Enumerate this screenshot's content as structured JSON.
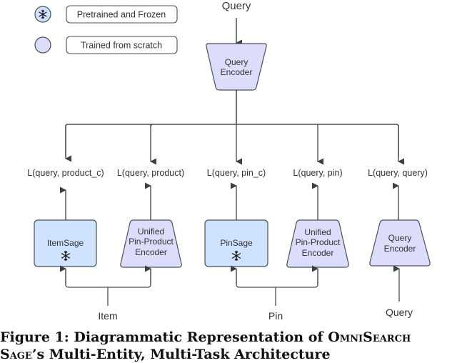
{
  "legend": {
    "items": [
      {
        "label": "Pretrained and Frozen",
        "icon": "snowflake-icon",
        "color": "#cfe2ff"
      },
      {
        "label": "Trained from scratch",
        "icon": "circle",
        "color": "#dcdcfb"
      }
    ]
  },
  "top": {
    "input_label": "Query",
    "encoder_label_line1": "Query",
    "encoder_label_line2": "Encoder"
  },
  "losses": [
    "L(query, product_c)",
    "L(query, product)",
    "L(query, pin_c)",
    "L(query, pin)",
    "L(query, query)"
  ],
  "encoders": [
    {
      "line1": "ItemSage",
      "frozen": true
    },
    {
      "line1": "Unified",
      "line2": "Pin-Product",
      "line3": "Encoder",
      "frozen": false
    },
    {
      "line1": "PinSage",
      "frozen": true
    },
    {
      "line1": "Unified",
      "line2": "Pin-Product",
      "line3": "Encoder",
      "frozen": false
    },
    {
      "line1": "Query",
      "line2": "Encoder",
      "frozen": false
    }
  ],
  "inputs": {
    "item": "Item",
    "pin": "Pin",
    "query": "Query"
  },
  "caption": {
    "prefix": "Figure 1: Diagrammatic Representation of ",
    "name_sc": "OmniSearch",
    "line2_name_sc": "Sage",
    "line2_rest": "’s Multi-Entity, Multi-Task Architecture"
  },
  "colors": {
    "frozen_fill": "#cfe2ff",
    "trained_fill": "#dcdcfb",
    "stroke": "#4a4f57",
    "arrow": "#3a3f47"
  }
}
